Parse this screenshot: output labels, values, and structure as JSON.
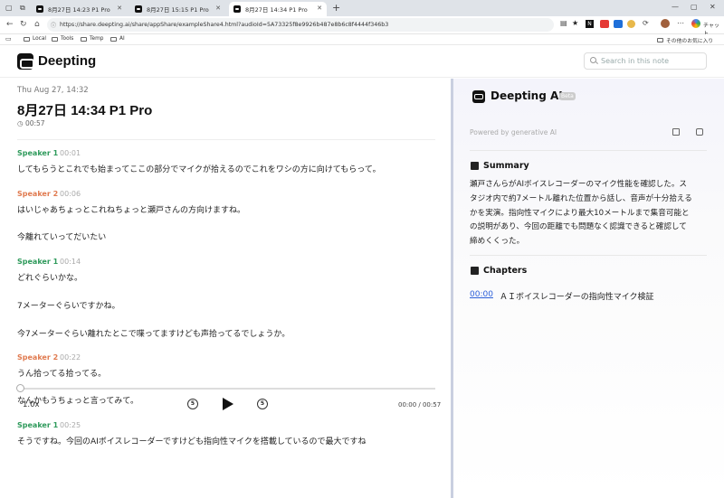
{
  "browser": {
    "tabs": [
      {
        "label": "8月27日 14:23 P1 Pro",
        "active": false
      },
      {
        "label": "8月27日 15:15 P1 Pro",
        "active": false
      },
      {
        "label": "8月27日 14:34 P1 Pro",
        "active": true
      }
    ],
    "new_tab": "+",
    "url": "https://share.deepting.ai/share/appShare/exampleShare4.html?audioId=5A73325f8e9926b487e8b6c8f4444f346b3",
    "bookmarks": [
      "Local",
      "Tools",
      "Temp",
      "AI"
    ],
    "other_bookmarks": "その他のお気に入り",
    "chat_label": "チャット"
  },
  "app": {
    "logo": "Deepting",
    "search_placeholder": "Search in this note"
  },
  "note": {
    "date": "Thu Aug 27, 14:32",
    "title": "8月27日 14:34 P1 Pro",
    "duration": "00:57",
    "transcript": [
      {
        "speaker": "Speaker 1",
        "time": "00:01",
        "lines": [
          "してもらうとこれでも始まってここの部分でマイクが拾えるのでこれをワシの方に向けてもらって。"
        ]
      },
      {
        "speaker": "Speaker 2",
        "time": "00:06",
        "lines": [
          "はいじゃあちょっとこれねちょっと瀬戸さんの方向けますね。",
          "今離れていってだいたい"
        ]
      },
      {
        "speaker": "Speaker 1",
        "time": "00:14",
        "lines": [
          "どれぐらいかな。",
          "7メーターぐらいですかね。",
          "今7メーターぐらい離れたとこで喋ってますけども声拾ってるでしょうか。"
        ]
      },
      {
        "speaker": "Speaker 2",
        "time": "00:22",
        "lines": [
          "うん拾ってる拾ってる。",
          "なんかもうちょっと言ってみて。"
        ]
      },
      {
        "speaker": "Speaker 1",
        "time": "00:25",
        "lines": [
          "そうですね。今回のAIボイスレコーダーですけども指向性マイクを搭載しているので最大ですね"
        ]
      }
    ],
    "speaker_colors": {
      "Speaker 1": "#2e9a5b",
      "Speaker 2": "#e07a4f"
    }
  },
  "player": {
    "speed": "1.0x",
    "skip_back": "5",
    "skip_forward": "5",
    "timecode": "00:00 / 00:57",
    "progress": 0
  },
  "ai_panel": {
    "title": "Deepting AI",
    "badge": "Beta",
    "powered_by": "Powered by generative AI",
    "summary_heading": "Summary",
    "summary_lines": [
      "瀬戸さんらがAIボイスレコーダーのマイク性能を確認した。ス",
      "タジオ内で約7メートル離れた位置から話し、音声が十分拾える",
      "かを実演。指向性マイクにより最大10メートルまで集音可能と",
      "の説明があり、今回の距離でも問題なく認識できると確認して",
      "締めくくった。"
    ],
    "chapters_heading": "Chapters",
    "chapters": [
      {
        "time": "00:00",
        "title": "ＡＩボイスレコーダーの指向性マイク検証"
      }
    ]
  }
}
